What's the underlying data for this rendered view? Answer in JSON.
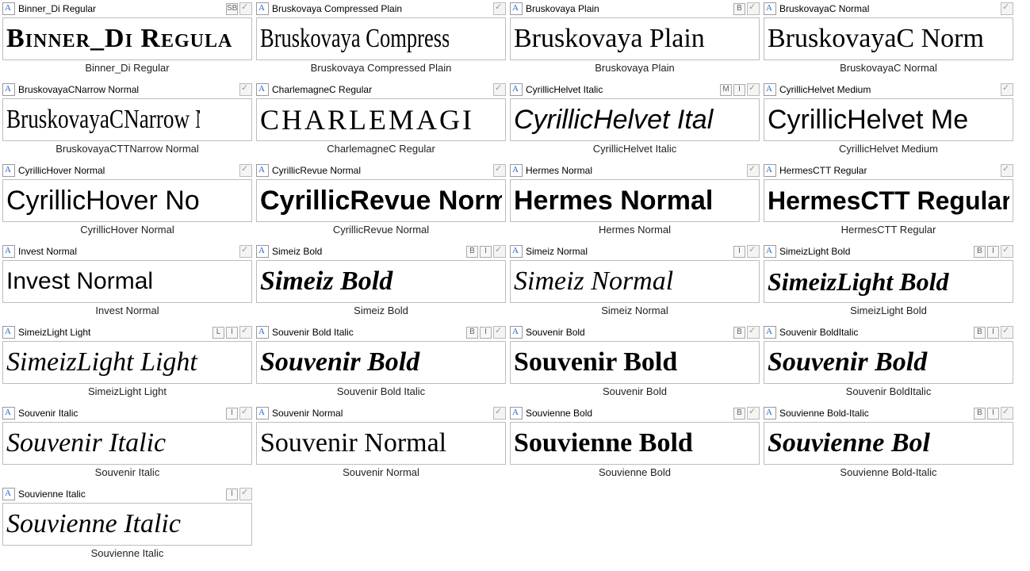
{
  "fonts": [
    {
      "name": "Binner_Di Regular",
      "badges": [
        "SB"
      ],
      "preview": "Binner_Di Regula",
      "caption": "Binner_Di Regular",
      "previewStyle": "font-family:Georgia,serif;font-weight:700;font-variant:small-caps;letter-spacing:1px"
    },
    {
      "name": "Bruskovaya Compressed Plain",
      "badges": [],
      "preview": "Bruskovaya Compressed Pla",
      "caption": "Bruskovaya Compressed Plain",
      "previewStyle": "font-family:'Times New Roman',serif;font-stretch:condensed;transform:scaleX(.78);transform-origin:left"
    },
    {
      "name": "Bruskovaya Plain",
      "badges": [
        "B"
      ],
      "preview": "Bruskovaya Plain",
      "caption": "Bruskovaya Plain",
      "previewStyle": "font-family:'Times New Roman',serif"
    },
    {
      "name": "BruskovayaC Normal",
      "badges": [],
      "preview": "BruskovayaC Norm",
      "caption": "BruskovayaC Normal",
      "previewStyle": "font-family:'Times New Roman',serif"
    },
    {
      "name": "BruskovayaCNarrow Normal",
      "badges": [],
      "preview": "BruskovayaCNarrow Norma",
      "caption": "BruskovayaCTTNarrow Normal",
      "previewStyle": "font-family:'Times New Roman',serif;transform:scaleX(.8);transform-origin:left"
    },
    {
      "name": "CharlemagneC Regular",
      "badges": [],
      "preview": "CHARLEMAGI",
      "caption": "CharlemagneC Regular",
      "previewStyle": "font-family:'Times New Roman',serif;letter-spacing:3px;font-size:36px"
    },
    {
      "name": "CyrillicHelvet Italic",
      "badges": [
        "M",
        "I"
      ],
      "preview": "CyrillicHelvet Ital",
      "caption": "CyrillicHelvet Italic",
      "previewStyle": "font-family:Arial,Helvetica,sans-serif;font-style:italic"
    },
    {
      "name": "CyrillicHelvet Medium",
      "badges": [],
      "preview": "CyrillicHelvet Me",
      "caption": "CyrillicHelvet Medium",
      "previewStyle": "font-family:Arial,Helvetica,sans-serif"
    },
    {
      "name": "CyrillicHover Normal",
      "badges": [],
      "preview": "CyrillicHover No",
      "caption": "CyrillicHover Normal",
      "previewStyle": "font-family:'Comic Sans MS',cursive,sans-serif"
    },
    {
      "name": "CyrillicRevue Normal",
      "badges": [],
      "preview": "CyrillicRevue Norm",
      "caption": "CyrillicRevue Normal",
      "previewStyle": "font-family:Impact,Arial Black,sans-serif;font-weight:700"
    },
    {
      "name": "Hermes Normal",
      "badges": [],
      "preview": "Hermes Normal",
      "caption": "Hermes Normal",
      "previewStyle": "font-family:'Arial Black',Arial,sans-serif;font-weight:900"
    },
    {
      "name": "HermesCTT Regular",
      "badges": [],
      "preview": "HermesCTT Regular",
      "caption": "HermesCTT Regular",
      "previewStyle": "font-family:'Arial Black',Arial,sans-serif;font-weight:900;font-size:32px"
    },
    {
      "name": "Invest Normal",
      "badges": [],
      "preview": "Invest   Normal",
      "caption": "Invest Normal",
      "previewStyle": "font-family:Arial,Helvetica,sans-serif;font-size:30px"
    },
    {
      "name": "Simeiz Bold",
      "badges": [
        "B",
        "I"
      ],
      "preview": "Simeiz  Bold",
      "caption": "Simeiz Bold",
      "previewStyle": "font-family:Georgia,serif;font-weight:700;font-style:italic"
    },
    {
      "name": "Simeiz Normal",
      "badges": [
        "I"
      ],
      "preview": "Simeiz  Normal",
      "caption": "Simeiz Normal",
      "previewStyle": "font-family:Georgia,serif;font-style:italic"
    },
    {
      "name": "SimeizLight Bold",
      "badges": [
        "B",
        "I"
      ],
      "preview": "SimeizLight  Bold",
      "caption": "SimeizLight Bold",
      "previewStyle": "font-family:Georgia,serif;font-weight:700;font-style:italic;font-size:32px"
    },
    {
      "name": "SimeizLight Light",
      "badges": [
        "L",
        "I"
      ],
      "preview": "SimeizLight  Light",
      "caption": "SimeizLight Light",
      "previewStyle": "font-family:Georgia,serif;font-style:italic;font-weight:300"
    },
    {
      "name": "Souvenir Bold Italic",
      "badges": [
        "B",
        "I"
      ],
      "preview": "Souvenir  Bold",
      "caption": "Souvenir Bold Italic",
      "previewStyle": "font-family:Georgia,'Bookman Old Style',serif;font-weight:700;font-style:italic"
    },
    {
      "name": "Souvenir Bold",
      "badges": [
        "B"
      ],
      "preview": "Souvenir Bold",
      "caption": "Souvenir Bold",
      "previewStyle": "font-family:Georgia,'Bookman Old Style',serif;font-weight:700"
    },
    {
      "name": "Souvenir BoldItalic",
      "badges": [
        "B",
        "I"
      ],
      "preview": "Souvenir Bold",
      "caption": "Souvenir BoldItalic",
      "previewStyle": "font-family:Georgia,'Bookman Old Style',serif;font-weight:700;font-style:italic"
    },
    {
      "name": "Souvenir Italic",
      "badges": [
        "I"
      ],
      "preview": "Souvenir Italic",
      "caption": "Souvenir Italic",
      "previewStyle": "font-family:Georgia,'Bookman Old Style',serif;font-style:italic"
    },
    {
      "name": "Souvenir Normal",
      "badges": [],
      "preview": "Souvenir Normal",
      "caption": "Souvenir Normal",
      "previewStyle": "font-family:Georgia,'Bookman Old Style',serif"
    },
    {
      "name": "Souvienne Bold",
      "badges": [
        "B"
      ],
      "preview": "Souvienne Bold",
      "caption": "Souvienne Bold",
      "previewStyle": "font-family:Georgia,'Bookman Old Style',serif;font-weight:900"
    },
    {
      "name": "Souvienne Bold-Italic",
      "badges": [
        "B",
        "I"
      ],
      "preview": "Souvienne Bol",
      "caption": "Souvienne Bold-Italic",
      "previewStyle": "font-family:Georgia,'Bookman Old Style',serif;font-weight:900;font-style:italic"
    },
    {
      "name": "Souvienne Italic",
      "badges": [
        "I"
      ],
      "preview": "Souvienne Italic",
      "caption": "Souvienne Italic",
      "previewStyle": "font-family:Georgia,'Bookman Old Style',serif;font-style:italic"
    }
  ]
}
